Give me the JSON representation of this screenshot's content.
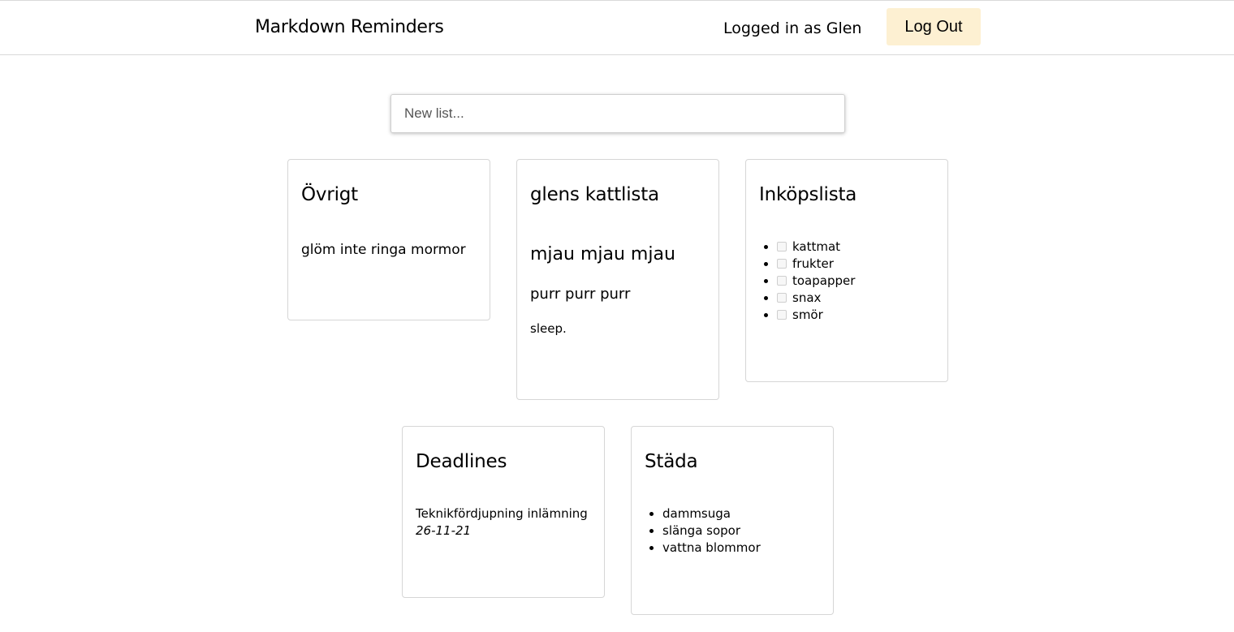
{
  "header": {
    "app_title": "Markdown Reminders",
    "logged_in_text": "Logged in as Glen",
    "logout_label": "Log Out",
    "logout_bg": "#fdf0d2"
  },
  "new_list": {
    "placeholder": "New list...",
    "value": ""
  },
  "lists": {
    "ovrigt": {
      "title": "Övrigt",
      "text": "glöm inte ringa mormor"
    },
    "katt": {
      "title": "glens kattlista",
      "heading": "mjau mjau mjau",
      "subheading": "purr purr purr",
      "text": "sleep."
    },
    "inkop": {
      "title": "Inköpslista",
      "items": [
        {
          "label": "kattmat",
          "checked": false
        },
        {
          "label": "frukter",
          "checked": false
        },
        {
          "label": "toapapper",
          "checked": false
        },
        {
          "label": "snax",
          "checked": false
        },
        {
          "label": "smör",
          "checked": false
        }
      ]
    },
    "deadlines": {
      "title": "Deadlines",
      "text": "Teknikfördjupning inlämning",
      "date": "26-11-21"
    },
    "stada": {
      "title": "Städa",
      "items": [
        "dammsuga",
        "slänga sopor",
        "vattna blommor"
      ]
    }
  }
}
